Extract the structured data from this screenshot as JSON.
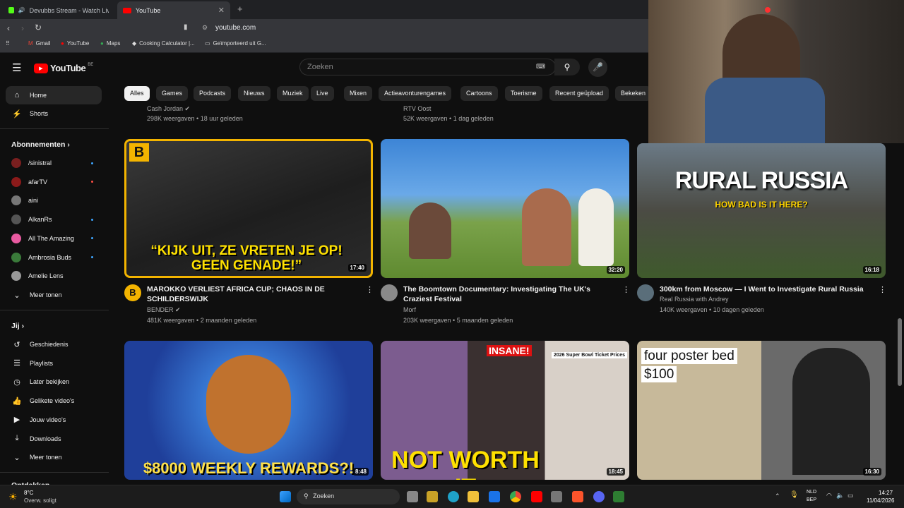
{
  "browser": {
    "tabs": [
      {
        "label": "Devubbs Stream - Watch Live on"
      },
      {
        "label": "YouTube"
      }
    ],
    "url": "youtube.com",
    "bookmarks": [
      "Gmail",
      "YouTube",
      "Maps",
      "Cooking Calculator |...",
      "Geïmporteerd uit G..."
    ]
  },
  "header": {
    "logo": "YouTube",
    "region": "BE",
    "search_placeholder": "Zoeken"
  },
  "sidebar": {
    "home": "Home",
    "shorts": "Shorts",
    "subscriptions_title": "Abonnementen",
    "subscriptions": [
      {
        "label": "/sinistral",
        "color": "#7a1f1f"
      },
      {
        "label": "afarTV",
        "color": "#8b1a1a"
      },
      {
        "label": "aini",
        "color": "#777777"
      },
      {
        "label": "AlkanRs",
        "color": "#555555"
      },
      {
        "label": "All The Amazing",
        "color": "#e85aa0"
      },
      {
        "label": "Ambrosia Buds",
        "color": "#3a7a3a"
      },
      {
        "label": "Amelie Lens",
        "color": "#999999"
      }
    ],
    "show_more": "Meer tonen",
    "you_title": "Jij",
    "you_items": [
      "Geschiedenis",
      "Playlists",
      "Later bekijken",
      "Gelikete video's",
      "Jouw video's",
      "Downloads"
    ],
    "show_more2": "Meer tonen",
    "explore_partial": "Ontdekken"
  },
  "chips": [
    "Alles",
    "Games",
    "Podcasts",
    "Nieuws",
    "Muziek",
    "Live",
    "Mixen",
    "Actieavonturengames",
    "Cartoons",
    "Toerisme",
    "Recent geüpload",
    "Bekeken"
  ],
  "top_row_partial": [
    {
      "channel": "Cash Jordan",
      "stats": "298K weergaven • 18 uur geleden"
    },
    {
      "channel": "RTV Oost",
      "stats": "52K weergaven • 1 dag geleden"
    }
  ],
  "videos": [
    {
      "title": "MAROKKO VERLIEST AFRICA CUP; CHAOS IN DE SCHILDERSWIJK",
      "channel": "BENDER",
      "stats": "481K weergaven • 2 maanden geleden",
      "duration": "17:40",
      "caption": "“KIJK UIT, ZE VRETEN JE OP! GEEN GENADE!”"
    },
    {
      "title": "The Boomtown Documentary: Investigating The UK's Craziest Festival",
      "channel": "Morf",
      "stats": "203K weergaven • 5 maanden geleden",
      "duration": "32:20",
      "caption": ""
    },
    {
      "title": "300km from Moscow — I Went to Investigate Rural Russia",
      "channel": "Real Russia with Andrey",
      "stats": "140K weergaven • 10 dagen geleden",
      "duration": "16:18",
      "caption": "RURAL RUSSIA",
      "caption2": "HOW BAD IS IT HERE?"
    },
    {
      "title": "",
      "channel": "",
      "stats": "",
      "duration": "8:48",
      "caption": "$8000 WEEKLY REWARDS?!"
    },
    {
      "title": "",
      "channel": "",
      "stats": "",
      "duration": "18:45",
      "caption": "NOT WORTH IT",
      "caption2": "INSANE!",
      "caption3": "2026 Super Bowl Ticket Prices"
    },
    {
      "title": "",
      "channel": "",
      "stats": "",
      "duration": "16:30",
      "caption": "four poster bed",
      "caption2": "$100"
    }
  ],
  "taskbar": {
    "weather_temp": "8°C",
    "weather_desc": "Overw. soligt",
    "search": "Zoeken",
    "lang": "NLD",
    "lang2": "BEP",
    "time": "14:27",
    "date": "11/04/2026"
  }
}
